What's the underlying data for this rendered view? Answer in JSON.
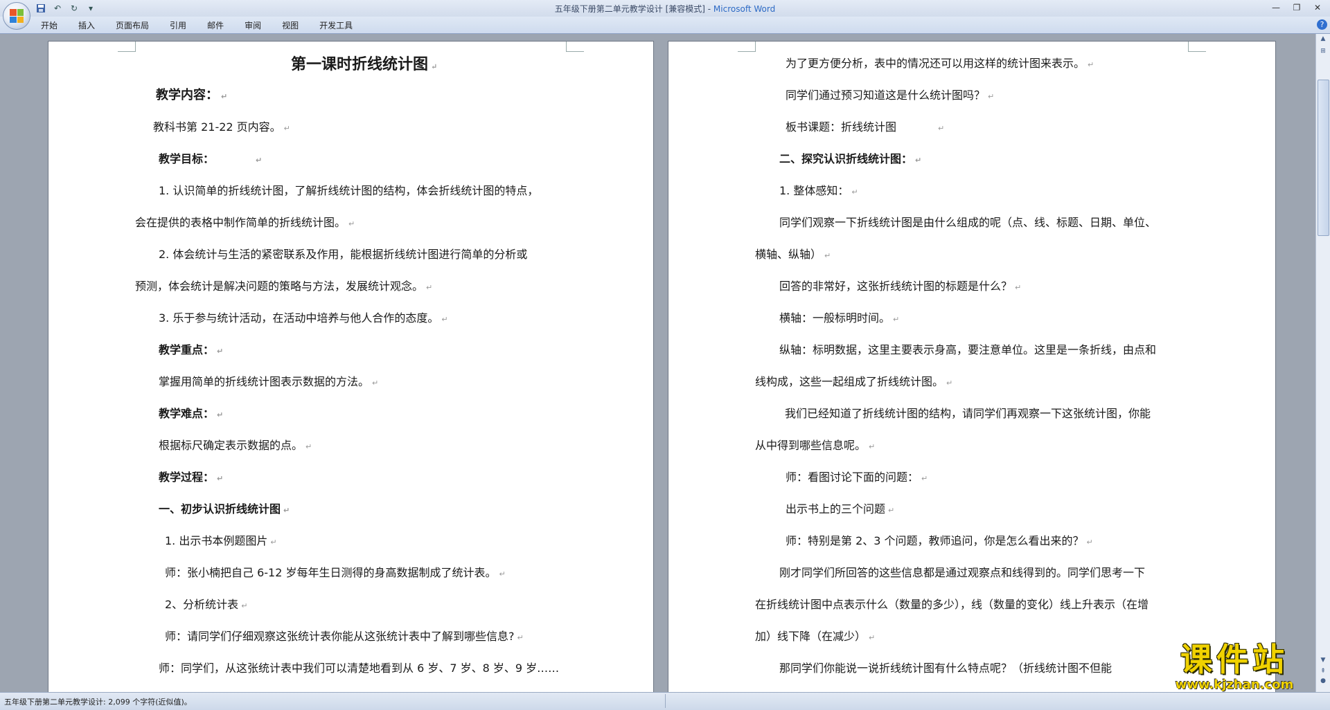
{
  "window": {
    "title_doc": "五年级下册第二单元教学设计 [兼容模式] - ",
    "title_app": "Microsoft Word"
  },
  "ribbon": {
    "tabs": [
      "开始",
      "插入",
      "页面布局",
      "引用",
      "邮件",
      "审阅",
      "视图",
      "开发工具"
    ]
  },
  "page1": {
    "lines": [
      "第一课时折线统计图",
      "教学内容：",
      "教科书第 21-22 页内容。",
      "教学目标：",
      "1. 认识简单的折线统计图，了解折线统计图的结构，体会折线统计图的特点，",
      "会在提供的表格中制作简单的折线统计图。",
      "2. 体会统计与生活的紧密联系及作用，能根据折线统计图进行简单的分析或",
      "预测，体会统计是解决问题的策略与方法，发展统计观念。",
      "3. 乐于参与统计活动，在活动中培养与他人合作的态度。",
      "教学重点：",
      "掌握用简单的折线统计图表示数据的方法。",
      "教学难点：",
      "根据标尺确定表示数据的点。",
      "教学过程：",
      "一、初步认识折线统计图",
      "1.  出示书本例题图片",
      "师：张小楠把自己 6-12 岁每年生日测得的身高数据制成了统计表。",
      "2、分析统计表",
      "师：请同学们仔细观察这张统计表你能从这张统计表中了解到哪些信息?",
      "师：同学们，从这张统计表中我们可以清楚地看到从 6 岁、7 岁、8 岁、9 岁……"
    ]
  },
  "page2": {
    "lines": [
      "为了更方便分析，表中的情况还可以用这样的统计图来表示。",
      "同学们通过预习知道这是什么统计图吗？",
      "板书课题：折线统计图",
      "二、探究认识折线统计图：",
      "1. 整体感知：",
      "同学们观察一下折线统计图是由什么组成的呢（点、线、标题、日期、单位、",
      "横轴、纵轴）",
      "回答的非常好，这张折线统计图的标题是什么？",
      "横轴：一般标明时间。",
      "纵轴：标明数据，这里主要表示身高，要注意单位。这里是一条折线，由点和",
      "线构成，这些一起组成了折线统计图。",
      "我们已经知道了折线统计图的结构，请同学们再观察一下这张统计图，你能",
      "从中得到哪些信息呢。",
      "师：看图讨论下面的问题：",
      "出示书上的三个问题",
      "师：特别是第 2、3 个问题，教师追问，你是怎么看出来的？",
      "刚才同学们所回答的这些信息都是通过观察点和线得到的。同学们思考一下",
      "在折线统计图中点表示什么（数量的多少），线（数量的变化）线上升表示（在增",
      "加）线下降（在减少）",
      "那同学们你能说一说折线统计图有什么特点呢？（折线统计图不但能"
    ]
  },
  "status": {
    "text": "五年级下册第二单元教学设计: 2,099 个字符(近似值)。"
  },
  "watermark": {
    "main": "课件站",
    "url": "www.kjzhan.com"
  },
  "colors": {
    "accent": "#2d6ac5",
    "watermark": "#f0d200",
    "background": "#9da5b1"
  }
}
